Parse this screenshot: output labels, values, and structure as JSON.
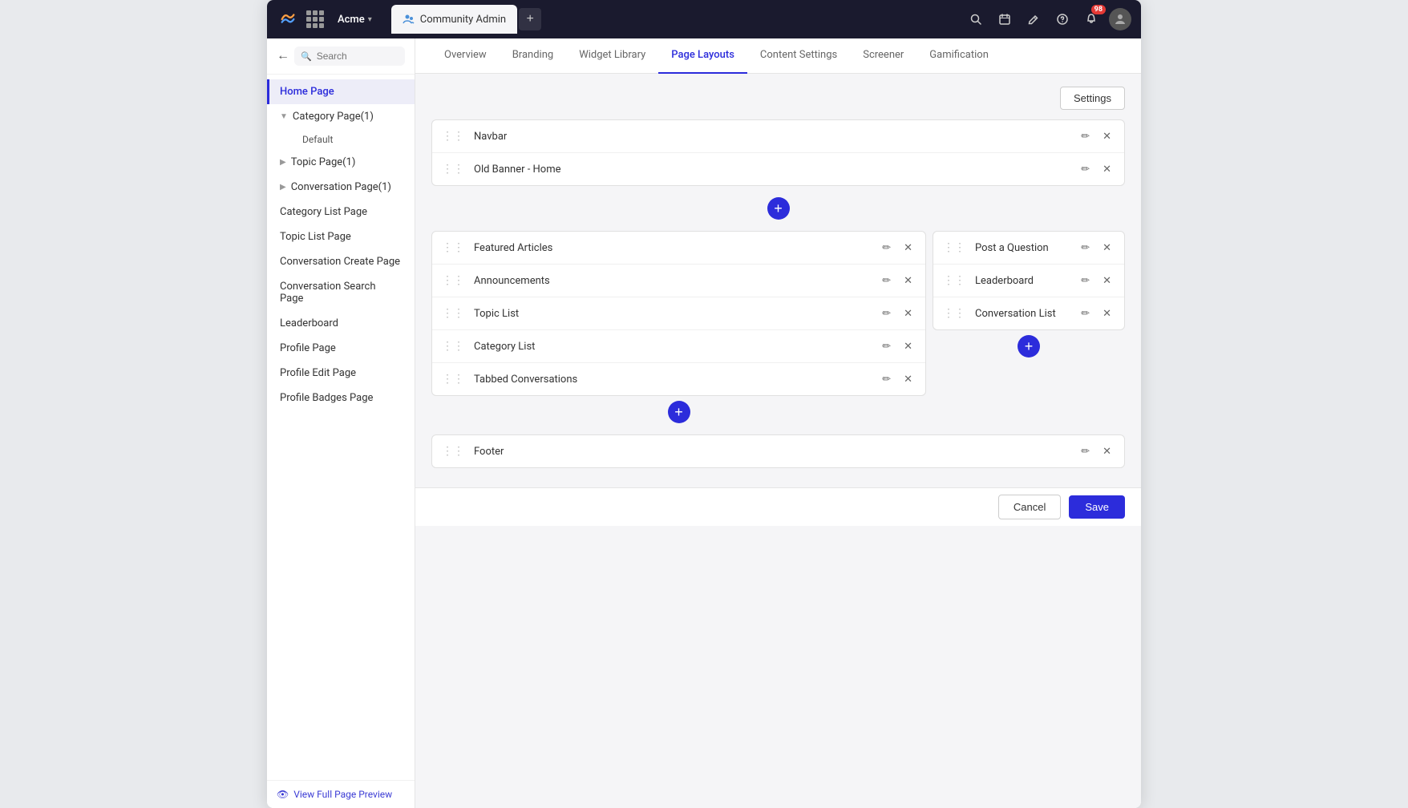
{
  "topBar": {
    "appName": "Acme",
    "tabLabel": "Community Admin",
    "tabIconColor": "#4a90d9",
    "addTabLabel": "+",
    "notifications": {
      "count": "98"
    }
  },
  "subNav": {
    "items": [
      {
        "id": "overview",
        "label": "Overview",
        "active": false
      },
      {
        "id": "branding",
        "label": "Branding",
        "active": false
      },
      {
        "id": "widget-library",
        "label": "Widget Library",
        "active": false
      },
      {
        "id": "page-layouts",
        "label": "Page Layouts",
        "active": true
      },
      {
        "id": "content-settings",
        "label": "Content Settings",
        "active": false
      },
      {
        "id": "screener",
        "label": "Screener",
        "active": false
      },
      {
        "id": "gamification",
        "label": "Gamification",
        "active": false
      }
    ]
  },
  "sidebar": {
    "searchPlaceholder": "Search",
    "items": [
      {
        "id": "home-page",
        "label": "Home Page",
        "active": true,
        "expandable": false
      },
      {
        "id": "category-page",
        "label": "Category Page(1)",
        "active": false,
        "expandable": true,
        "expanded": true
      },
      {
        "id": "default",
        "label": "Default",
        "active": false,
        "sub": true
      },
      {
        "id": "topic-page",
        "label": "Topic Page(1)",
        "active": false,
        "expandable": true,
        "expanded": false
      },
      {
        "id": "conversation-page",
        "label": "Conversation Page(1)",
        "active": false,
        "expandable": true,
        "expanded": false
      },
      {
        "id": "category-list-page",
        "label": "Category List Page",
        "active": false,
        "expandable": false
      },
      {
        "id": "topic-list-page",
        "label": "Topic List Page",
        "active": false,
        "expandable": false
      },
      {
        "id": "conversation-create-page",
        "label": "Conversation Create Page",
        "active": false,
        "expandable": false
      },
      {
        "id": "conversation-search-page",
        "label": "Conversation Search Page",
        "active": false,
        "expandable": false
      },
      {
        "id": "leaderboard",
        "label": "Leaderboard",
        "active": false,
        "expandable": false
      },
      {
        "id": "profile-page",
        "label": "Profile Page",
        "active": false,
        "expandable": false
      },
      {
        "id": "profile-edit-page",
        "label": "Profile Edit Page",
        "active": false,
        "expandable": false
      },
      {
        "id": "profile-badges-page",
        "label": "Profile Badges Page",
        "active": false,
        "expandable": false
      }
    ],
    "footerLink": "View Full Page Preview"
  },
  "content": {
    "settingsLabel": "Settings",
    "topWidgets": [
      {
        "id": "navbar",
        "name": "Navbar"
      },
      {
        "id": "old-banner-home",
        "name": "Old Banner - Home"
      }
    ],
    "leftColWidgets": [
      {
        "id": "featured-articles",
        "name": "Featured Articles"
      },
      {
        "id": "announcements",
        "name": "Announcements"
      },
      {
        "id": "topic-list",
        "name": "Topic List"
      },
      {
        "id": "category-list",
        "name": "Category List"
      },
      {
        "id": "tabbed-conversations",
        "name": "Tabbed Conversations"
      }
    ],
    "rightColWidgets": [
      {
        "id": "post-a-question",
        "name": "Post a Question"
      },
      {
        "id": "leaderboard",
        "name": "Leaderboard"
      },
      {
        "id": "conversation-list",
        "name": "Conversation List"
      }
    ],
    "bottomWidgets": [
      {
        "id": "footer",
        "name": "Footer"
      }
    ]
  },
  "actionBar": {
    "cancelLabel": "Cancel",
    "saveLabel": "Save"
  }
}
